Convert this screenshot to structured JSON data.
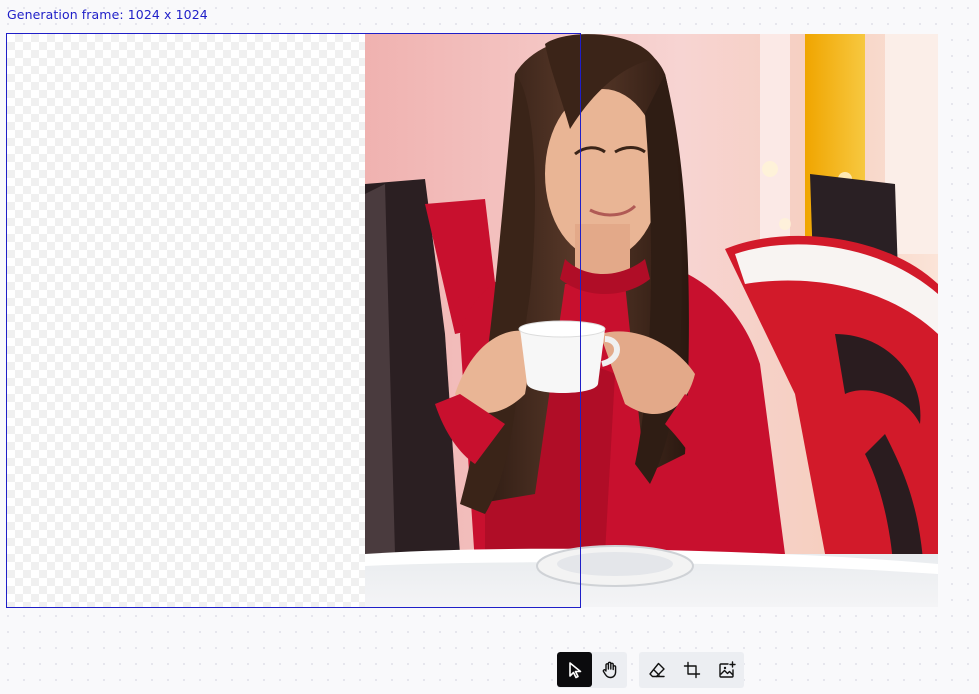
{
  "frame": {
    "label": "Generation frame: 1024 x 1024",
    "border_color": "#1f1fc8"
  },
  "image": {
    "description_icon": "photo-placeholder",
    "colors": {
      "sweater": "#c8102e",
      "chair": "#d21a2a",
      "background": "#f4c6c2",
      "hair": "#3a2418",
      "skin": "#e9b595",
      "cup": "#f7f7f7"
    }
  },
  "toolbar": {
    "groups": [
      {
        "tools": [
          {
            "name": "select",
            "icon": "cursor-arrow-icon",
            "active": true
          },
          {
            "name": "pan",
            "icon": "hand-icon",
            "active": false
          }
        ]
      },
      {
        "tools": [
          {
            "name": "eraser",
            "icon": "eraser-icon",
            "active": false
          },
          {
            "name": "crop",
            "icon": "crop-frame-icon",
            "active": false
          },
          {
            "name": "add-image",
            "icon": "image-add-icon",
            "active": false
          }
        ]
      }
    ]
  }
}
